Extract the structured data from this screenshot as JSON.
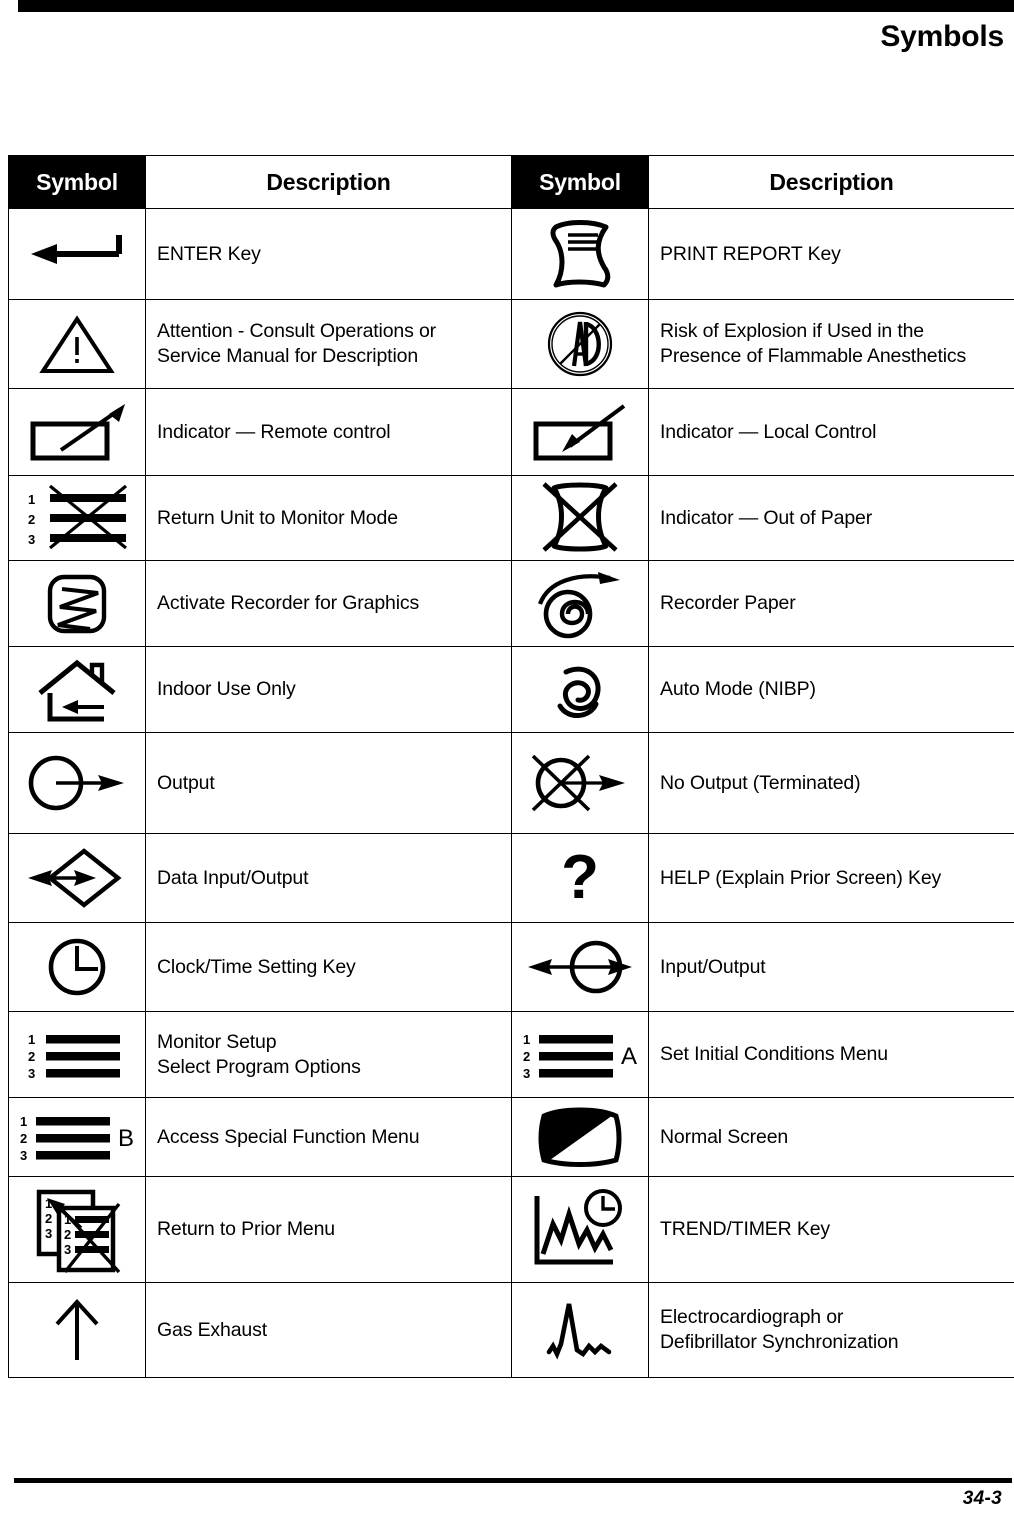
{
  "header": {
    "title": "Symbols"
  },
  "table": {
    "columns": [
      "Symbol",
      "Description",
      "Symbol",
      "Description"
    ],
    "rows": [
      {
        "left": {
          "symbol": "enter-key-arrow-icon",
          "description": [
            "ENTER Key"
          ]
        },
        "right": {
          "symbol": "print-report-paper-icon",
          "description": [
            "PRINT REPORT Key"
          ]
        }
      },
      {
        "left": {
          "symbol": "attention-triangle-icon",
          "description": [
            "Attention - Consult Operations or",
            "Service Manual for Description"
          ]
        },
        "right": {
          "symbol": "no-flammable-anesthetics-icon",
          "description": [
            "Risk of Explosion if Used in the",
            "Presence of Flammable Anesthetics"
          ]
        }
      },
      {
        "left": {
          "symbol": "indicator-remote-control-icon",
          "description": [
            "Indicator — Remote control"
          ]
        },
        "right": {
          "symbol": "indicator-local-control-icon",
          "description": [
            "Indicator — Local Control"
          ]
        }
      },
      {
        "left": {
          "symbol": "return-monitor-mode-icon",
          "description": [
            "Return Unit to Monitor Mode"
          ],
          "labels": [
            "1",
            "2",
            "3"
          ]
        },
        "right": {
          "symbol": "indicator-out-of-paper-icon",
          "description": [
            "Indicator — Out of Paper"
          ]
        }
      },
      {
        "left": {
          "symbol": "activate-recorder-icon",
          "description": [
            "Activate Recorder for Graphics"
          ]
        },
        "right": {
          "symbol": "recorder-paper-roll-icon",
          "description": [
            "Recorder Paper"
          ]
        }
      },
      {
        "left": {
          "symbol": "indoor-use-only-house-icon",
          "description": [
            "Indoor Use Only"
          ]
        },
        "right": {
          "symbol": "auto-mode-nibp-spiral-icon",
          "description": [
            "Auto Mode (NIBP)"
          ]
        }
      },
      {
        "left": {
          "symbol": "output-circle-arrow-icon",
          "description": [
            "Output"
          ]
        },
        "right": {
          "symbol": "no-output-terminated-icon",
          "description": [
            "No Output (Terminated)"
          ]
        }
      },
      {
        "left": {
          "symbol": "data-input-output-diamond-icon",
          "description": [
            "Data Input/Output"
          ]
        },
        "right": {
          "symbol": "help-question-mark-icon",
          "description": [
            "HELP (Explain Prior Screen) Key"
          ],
          "glyph": "?"
        }
      },
      {
        "left": {
          "symbol": "clock-time-setting-icon",
          "description": [
            "Clock/Time Setting Key"
          ]
        },
        "right": {
          "symbol": "input-output-circle-icon",
          "description": [
            "Input/Output"
          ]
        }
      },
      {
        "left": {
          "symbol": "monitor-setup-menu-icon",
          "description": [
            "Monitor Setup",
            "Select Program Options"
          ],
          "labels": [
            "1",
            "2",
            "3"
          ]
        },
        "right": {
          "symbol": "set-initial-conditions-menu-icon",
          "description": [
            "Set Initial Conditions Menu"
          ],
          "labels": [
            "1",
            "2",
            "3"
          ],
          "suffix": "A"
        }
      },
      {
        "left": {
          "symbol": "special-function-menu-icon",
          "description": [
            "Access Special Function Menu"
          ],
          "labels": [
            "1",
            "2",
            "3"
          ],
          "suffix": "B"
        },
        "right": {
          "symbol": "normal-screen-icon",
          "description": [
            "Normal Screen"
          ]
        }
      },
      {
        "left": {
          "symbol": "return-prior-menu-icon",
          "description": [
            "Return to Prior Menu"
          ],
          "labels": [
            "1",
            "2",
            "3"
          ],
          "labels2": [
            "1",
            "2",
            "3"
          ]
        },
        "right": {
          "symbol": "trend-timer-icon",
          "description": [
            "TREND/TIMER Key"
          ]
        }
      },
      {
        "left": {
          "symbol": "gas-exhaust-arrow-icon",
          "description": [
            "Gas Exhaust"
          ]
        },
        "right": {
          "symbol": "ecg-defib-sync-icon",
          "description": [
            "Electrocardiograph or",
            "Defibrillator Synchronization"
          ]
        }
      }
    ]
  },
  "footer": {
    "page_number": "34-3"
  }
}
